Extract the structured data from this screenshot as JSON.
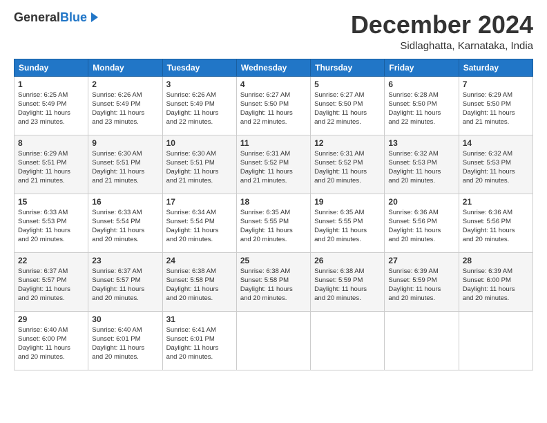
{
  "header": {
    "logo_general": "General",
    "logo_blue": "Blue",
    "month_title": "December 2024",
    "location": "Sidlaghatta, Karnataka, India"
  },
  "weekdays": [
    "Sunday",
    "Monday",
    "Tuesday",
    "Wednesday",
    "Thursday",
    "Friday",
    "Saturday"
  ],
  "weeks": [
    [
      {
        "day": "1",
        "sunrise": "6:25 AM",
        "sunset": "5:49 PM",
        "daylight": "11 hours and 23 minutes."
      },
      {
        "day": "2",
        "sunrise": "6:26 AM",
        "sunset": "5:49 PM",
        "daylight": "11 hours and 23 minutes."
      },
      {
        "day": "3",
        "sunrise": "6:26 AM",
        "sunset": "5:49 PM",
        "daylight": "11 hours and 22 minutes."
      },
      {
        "day": "4",
        "sunrise": "6:27 AM",
        "sunset": "5:50 PM",
        "daylight": "11 hours and 22 minutes."
      },
      {
        "day": "5",
        "sunrise": "6:27 AM",
        "sunset": "5:50 PM",
        "daylight": "11 hours and 22 minutes."
      },
      {
        "day": "6",
        "sunrise": "6:28 AM",
        "sunset": "5:50 PM",
        "daylight": "11 hours and 22 minutes."
      },
      {
        "day": "7",
        "sunrise": "6:29 AM",
        "sunset": "5:50 PM",
        "daylight": "11 hours and 21 minutes."
      }
    ],
    [
      {
        "day": "8",
        "sunrise": "6:29 AM",
        "sunset": "5:51 PM",
        "daylight": "11 hours and 21 minutes."
      },
      {
        "day": "9",
        "sunrise": "6:30 AM",
        "sunset": "5:51 PM",
        "daylight": "11 hours and 21 minutes."
      },
      {
        "day": "10",
        "sunrise": "6:30 AM",
        "sunset": "5:51 PM",
        "daylight": "11 hours and 21 minutes."
      },
      {
        "day": "11",
        "sunrise": "6:31 AM",
        "sunset": "5:52 PM",
        "daylight": "11 hours and 21 minutes."
      },
      {
        "day": "12",
        "sunrise": "6:31 AM",
        "sunset": "5:52 PM",
        "daylight": "11 hours and 20 minutes."
      },
      {
        "day": "13",
        "sunrise": "6:32 AM",
        "sunset": "5:53 PM",
        "daylight": "11 hours and 20 minutes."
      },
      {
        "day": "14",
        "sunrise": "6:32 AM",
        "sunset": "5:53 PM",
        "daylight": "11 hours and 20 minutes."
      }
    ],
    [
      {
        "day": "15",
        "sunrise": "6:33 AM",
        "sunset": "5:53 PM",
        "daylight": "11 hours and 20 minutes."
      },
      {
        "day": "16",
        "sunrise": "6:33 AM",
        "sunset": "5:54 PM",
        "daylight": "11 hours and 20 minutes."
      },
      {
        "day": "17",
        "sunrise": "6:34 AM",
        "sunset": "5:54 PM",
        "daylight": "11 hours and 20 minutes."
      },
      {
        "day": "18",
        "sunrise": "6:35 AM",
        "sunset": "5:55 PM",
        "daylight": "11 hours and 20 minutes."
      },
      {
        "day": "19",
        "sunrise": "6:35 AM",
        "sunset": "5:55 PM",
        "daylight": "11 hours and 20 minutes."
      },
      {
        "day": "20",
        "sunrise": "6:36 AM",
        "sunset": "5:56 PM",
        "daylight": "11 hours and 20 minutes."
      },
      {
        "day": "21",
        "sunrise": "6:36 AM",
        "sunset": "5:56 PM",
        "daylight": "11 hours and 20 minutes."
      }
    ],
    [
      {
        "day": "22",
        "sunrise": "6:37 AM",
        "sunset": "5:57 PM",
        "daylight": "11 hours and 20 minutes."
      },
      {
        "day": "23",
        "sunrise": "6:37 AM",
        "sunset": "5:57 PM",
        "daylight": "11 hours and 20 minutes."
      },
      {
        "day": "24",
        "sunrise": "6:38 AM",
        "sunset": "5:58 PM",
        "daylight": "11 hours and 20 minutes."
      },
      {
        "day": "25",
        "sunrise": "6:38 AM",
        "sunset": "5:58 PM",
        "daylight": "11 hours and 20 minutes."
      },
      {
        "day": "26",
        "sunrise": "6:38 AM",
        "sunset": "5:59 PM",
        "daylight": "11 hours and 20 minutes."
      },
      {
        "day": "27",
        "sunrise": "6:39 AM",
        "sunset": "5:59 PM",
        "daylight": "11 hours and 20 minutes."
      },
      {
        "day": "28",
        "sunrise": "6:39 AM",
        "sunset": "6:00 PM",
        "daylight": "11 hours and 20 minutes."
      }
    ],
    [
      {
        "day": "29",
        "sunrise": "6:40 AM",
        "sunset": "6:00 PM",
        "daylight": "11 hours and 20 minutes."
      },
      {
        "day": "30",
        "sunrise": "6:40 AM",
        "sunset": "6:01 PM",
        "daylight": "11 hours and 20 minutes."
      },
      {
        "day": "31",
        "sunrise": "6:41 AM",
        "sunset": "6:01 PM",
        "daylight": "11 hours and 20 minutes."
      },
      null,
      null,
      null,
      null
    ]
  ]
}
